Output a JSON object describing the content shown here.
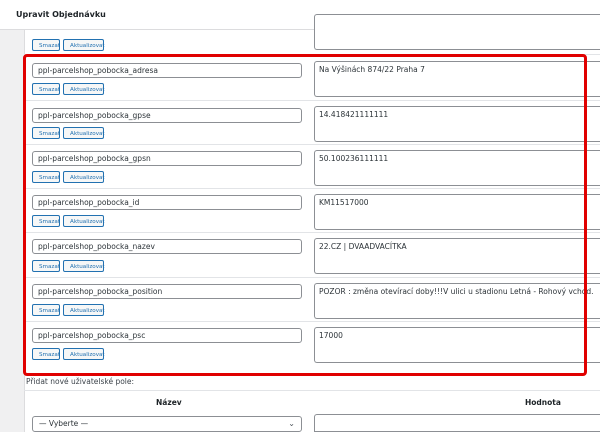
{
  "header": {
    "title": "Upravit Objednávku"
  },
  "buttons": {
    "delete": "Smazat",
    "update": "Aktualizovat"
  },
  "meta_rows": [
    {
      "key": "ppl-parcelshop_pobocka_adresa",
      "value": "Na Výšinách 874/22 Praha 7"
    },
    {
      "key": "ppl-parcelshop_pobocka_gpse",
      "value": "14.418421111111"
    },
    {
      "key": "ppl-parcelshop_pobocka_gpsn",
      "value": "50.100236111111"
    },
    {
      "key": "ppl-parcelshop_pobocka_id",
      "value": "KM11517000"
    },
    {
      "key": "ppl-parcelshop_pobocka_nazev",
      "value": "22.CZ | DVAADVACÍTKA"
    },
    {
      "key": "ppl-parcelshop_pobocka_position",
      "value": "POZOR : změna otevírací doby!!!V ulici u stadionu Letná - Rohový vchod."
    },
    {
      "key": "ppl-parcelshop_pobocka_psc",
      "value": "17000"
    }
  ],
  "add_section": {
    "label": "Přidat nové uživatelské pole:",
    "col_name": "Název",
    "col_value": "Hodnota",
    "select_value": "— Vyberte —"
  },
  "colors": {
    "highlight": "#e00000",
    "button_blue": "#2271b1"
  }
}
